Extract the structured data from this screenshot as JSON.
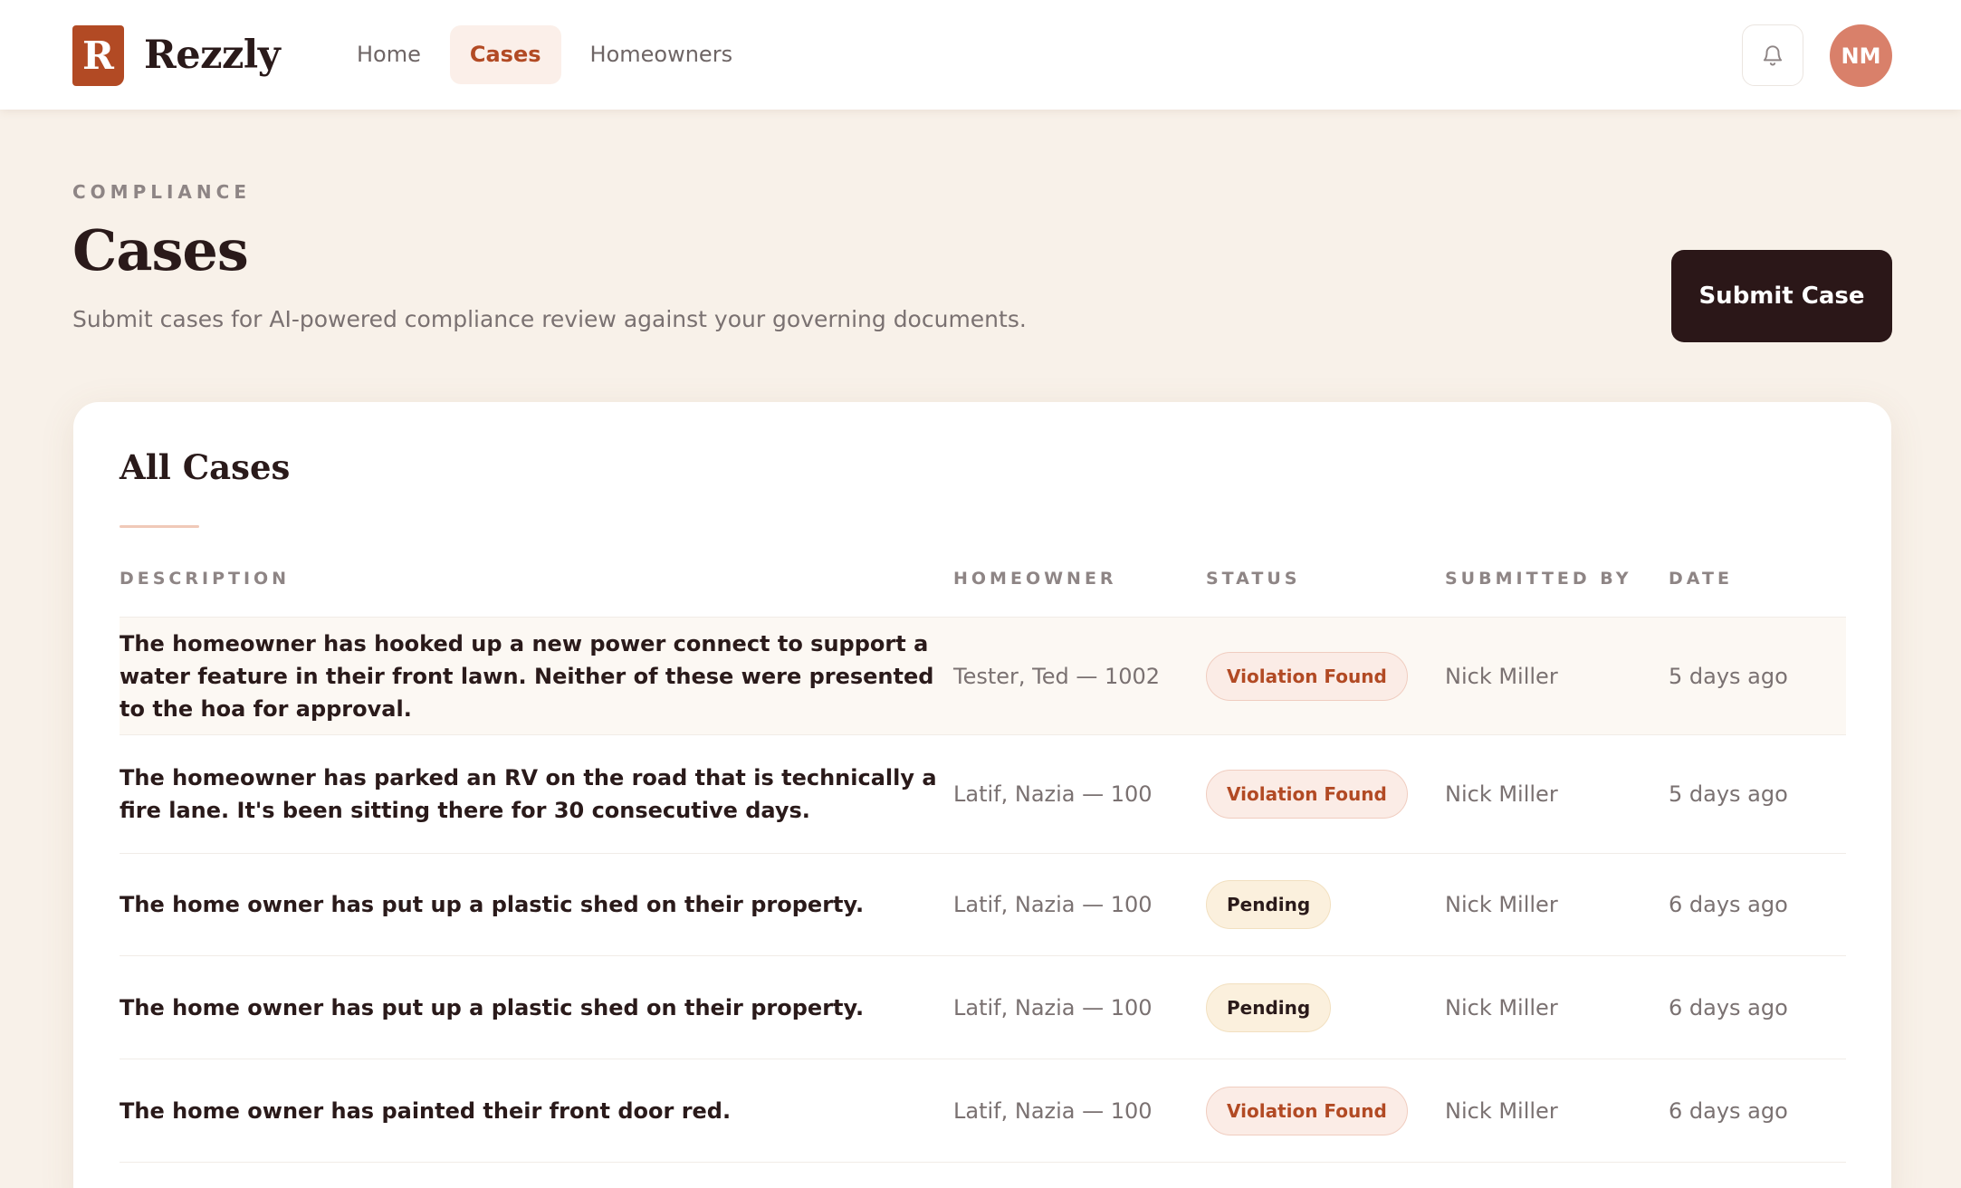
{
  "app": {
    "logo_letter": "R",
    "name": "Rezzly"
  },
  "nav": {
    "items": [
      {
        "label": "Home",
        "active": false
      },
      {
        "label": "Cases",
        "active": true
      },
      {
        "label": "Homeowners",
        "active": false
      }
    ],
    "notifications_icon": "bell-icon",
    "user_initials": "NM"
  },
  "header": {
    "eyebrow": "COMPLIANCE",
    "title": "Cases",
    "subtitle": "Submit cases for AI-powered compliance review against your governing documents.",
    "submit_label": "Submit Case"
  },
  "table": {
    "title": "All Cases",
    "columns": [
      "DESCRIPTION",
      "HOMEOWNER",
      "STATUS",
      "SUBMITTED BY",
      "DATE"
    ],
    "rows": [
      {
        "description": "The homeowner has hooked up a new power connect to support a water feature in their front lawn. Neither of these were presented to the hoa for approval.",
        "homeowner": "Tester, Ted — 1002",
        "status": "Violation Found",
        "submitted_by": "Nick Miller",
        "date": "5 days ago"
      },
      {
        "description": "The homeowner has parked an RV on the road that is technically a fire lane. It's been sitting there for 30 consecutive days.",
        "homeowner": "Latif, Nazia — 100",
        "status": "Violation Found",
        "submitted_by": "Nick Miller",
        "date": "5 days ago"
      },
      {
        "description": "The home owner has put up a plastic shed on their property.",
        "homeowner": "Latif, Nazia — 100",
        "status": "Pending",
        "submitted_by": "Nick Miller",
        "date": "6 days ago"
      },
      {
        "description": "The home owner has put up a plastic shed on their property.",
        "homeowner": "Latif, Nazia — 100",
        "status": "Pending",
        "submitted_by": "Nick Miller",
        "date": "6 days ago"
      },
      {
        "description": "The home owner has painted their front door red.",
        "homeowner": "Latif, Nazia — 100",
        "status": "Violation Found",
        "submitted_by": "Nick Miller",
        "date": "6 days ago"
      }
    ]
  },
  "colors": {
    "brand": "#b24a24",
    "background": "#f8f1e9",
    "primary_button": "#2b1718",
    "avatar": "#d9806a"
  }
}
